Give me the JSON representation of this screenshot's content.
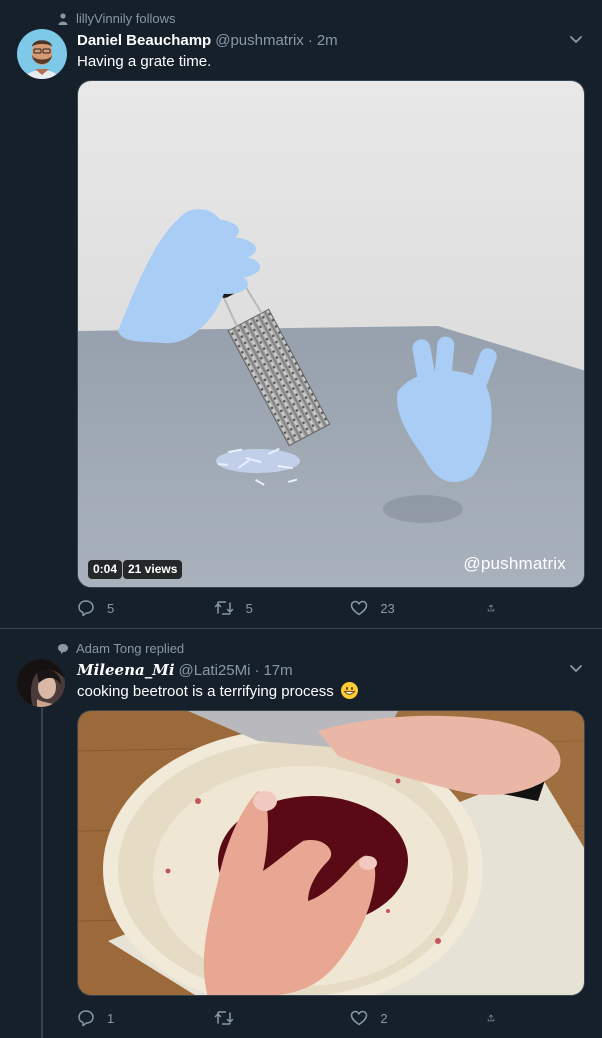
{
  "colors": {
    "background": "#15202b",
    "border": "#38444d",
    "secondary_text": "#8899a6",
    "primary_text": "#ffffff"
  },
  "tweets": [
    {
      "context_icon": "person-icon",
      "context": "lillyVinnily follows",
      "name": "Daniel Beauchamp",
      "handle": "@pushmatrix",
      "dot": "·",
      "time": "2m",
      "text": "Having a grate time.",
      "media": {
        "type": "video",
        "duration": "0:04",
        "views": "21 views",
        "watermark": "@pushmatrix"
      },
      "actions": {
        "reply": "5",
        "retweet": "5",
        "like": "23"
      }
    },
    {
      "context_icon": "speech-bubble-icon",
      "context": "Adam Tong replied",
      "name": "𝑴𝒊𝒍𝒆𝒆𝒏𝒂_𝑴𝒊",
      "handle": "@Lati25Mi",
      "dot": "·",
      "time": "17m",
      "text": "cooking beetroot is a terrifying process",
      "emoji": "grinning-face-emoji",
      "media": {
        "type": "photo"
      },
      "actions": {
        "reply": "1",
        "retweet": "",
        "like": "2"
      }
    }
  ]
}
